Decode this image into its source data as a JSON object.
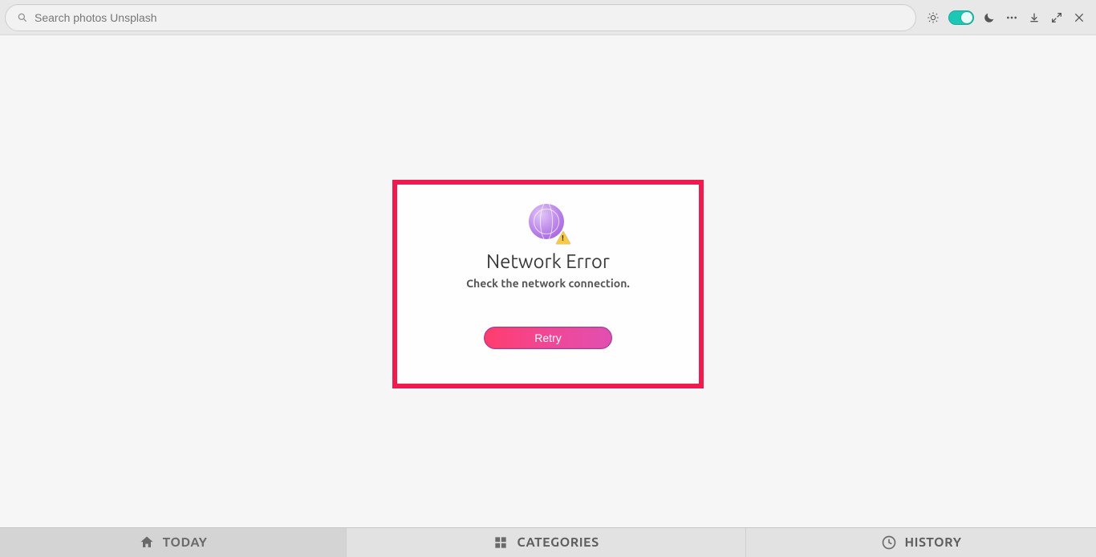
{
  "header": {
    "search_placeholder": "Search photos Unsplash"
  },
  "error": {
    "title": "Network Error",
    "subtitle": "Check the network connection.",
    "retry_label": "Retry"
  },
  "tabs": {
    "today": "TODAY",
    "categories": "CATEGORIES",
    "history": "HISTORY"
  }
}
